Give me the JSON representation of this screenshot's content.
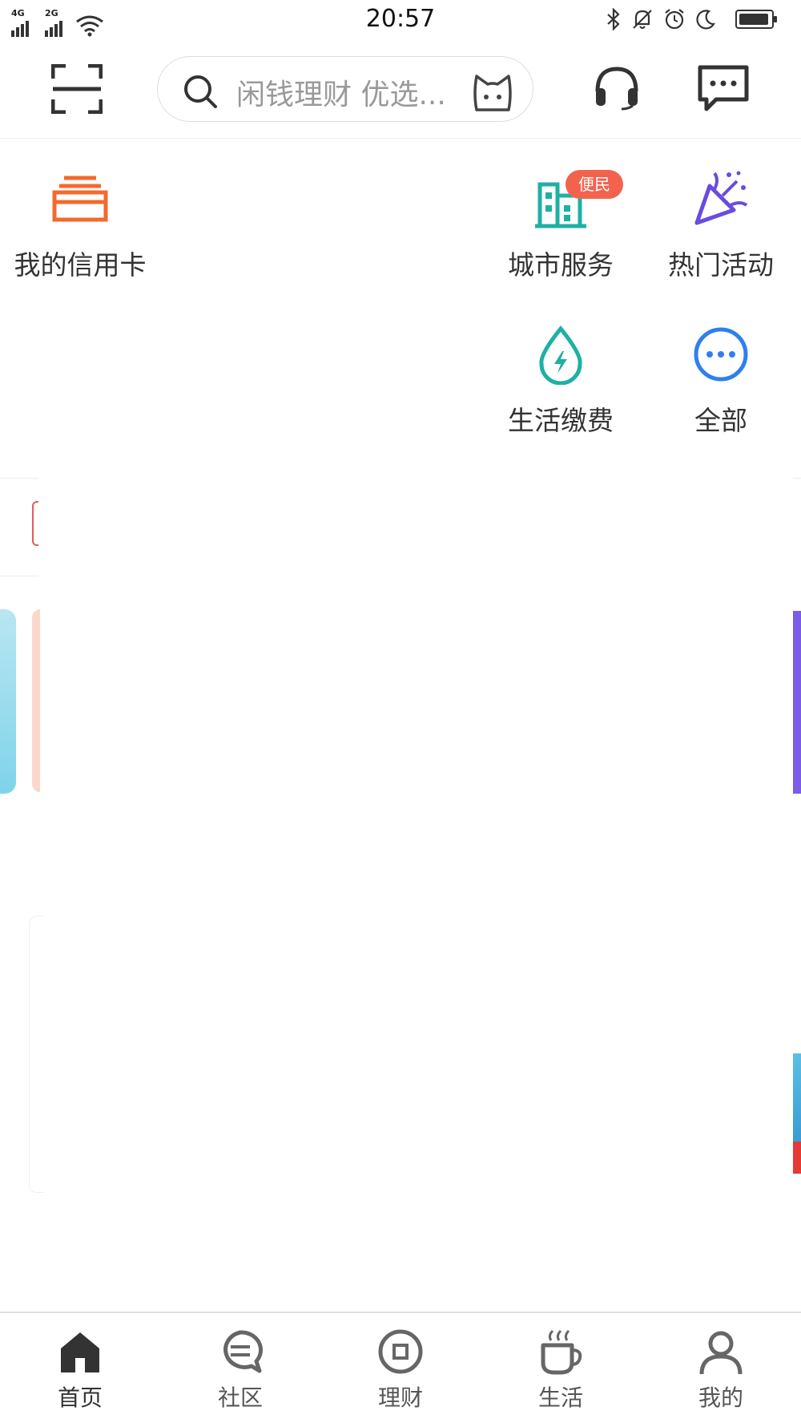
{
  "status_bar": {
    "network1": "4G",
    "network2": "2G",
    "time": "20:57"
  },
  "header": {
    "search_placeholder": "闲钱理财 优选..."
  },
  "shortcuts": {
    "credit_card": "我的信用卡",
    "city_service": "城市服务",
    "city_service_badge": "便民",
    "hot_activity": "热门活动",
    "life_payment": "生活缴费",
    "all": "全部"
  },
  "bottom_nav": {
    "items": [
      {
        "label": "首页",
        "icon": "home-icon",
        "active": true
      },
      {
        "label": "社区",
        "icon": "community-icon"
      },
      {
        "label": "理财",
        "icon": "finance-icon"
      },
      {
        "label": "生活",
        "icon": "coffee-icon"
      },
      {
        "label": "我的",
        "icon": "user-icon"
      }
    ]
  },
  "colors": {
    "credit_orange": "#f26a2e",
    "city_teal": "#1fb0a5",
    "hot_purple": "#6a4be0",
    "pay_teal": "#1fb0a5",
    "all_blue": "#2f7ff0",
    "badge_red": "#f2634e"
  }
}
